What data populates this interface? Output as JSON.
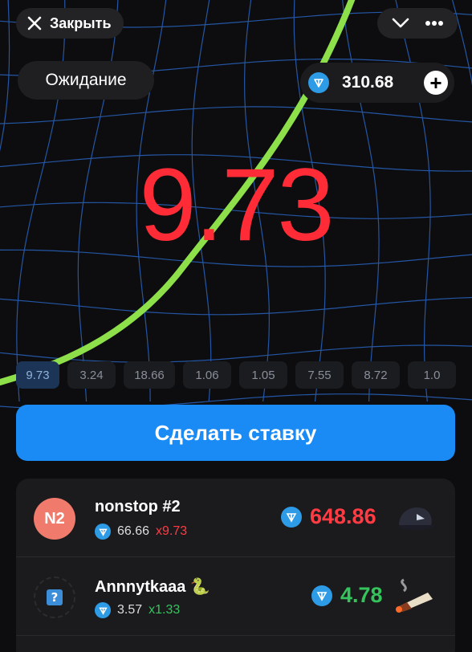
{
  "header": {
    "close_label": "Закрыть",
    "status_label": "Ожидание",
    "balance": "310.68",
    "plus_label": "+"
  },
  "game": {
    "multiplier": "9.73",
    "history": [
      "9.73",
      "3.24",
      "18.66",
      "1.06",
      "1.05",
      "7.55",
      "8.72",
      "1.0"
    ]
  },
  "actions": {
    "bet_label": "Сделать ставку"
  },
  "bets": [
    {
      "avatar_text": "N2",
      "username": "nonstop #2",
      "stake": "66.66",
      "multiplier": "x9.73",
      "win": "648.86",
      "gift_icon": "cap-gift-icon"
    },
    {
      "avatar_text": "?",
      "username": "Annnytkaaa 🐍",
      "stake": "3.57",
      "multiplier": "x1.33",
      "win": "4.78",
      "gift_icon": "cigar-gift-icon"
    }
  ],
  "colors": {
    "accent_blue": "#1a8bf5",
    "multiplier_red": "#ff2b36",
    "win_green": "#35c45c",
    "curve_green": "#8ee04a",
    "ton_blue": "#2e9be6",
    "grid_blue": "#2c6fd6"
  }
}
